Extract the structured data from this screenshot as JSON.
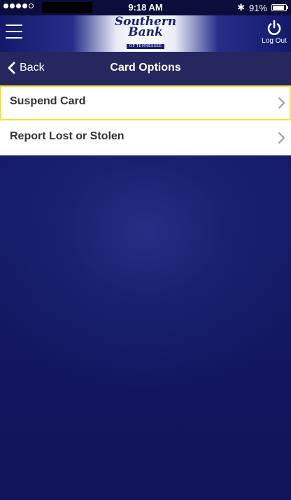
{
  "status_bar": {
    "time": "9:18 AM",
    "battery_percent": "91%",
    "battery_level": 0.91,
    "signal_bars": 4
  },
  "header": {
    "logo": {
      "line1": "Southern",
      "line2": "Bank",
      "line3": "OF TENNESSEE"
    },
    "logout_label": "Log Out",
    "menu_icon": "hamburger-menu-icon",
    "logout_icon": "power-icon"
  },
  "nav": {
    "back_label": "Back",
    "title": "Card Options"
  },
  "options": [
    {
      "label": "Suspend Card",
      "highlighted": true
    },
    {
      "label": "Report Lost or Stolen",
      "highlighted": false
    }
  ],
  "colors": {
    "background": "#141a66",
    "nav_bar": "#25275e",
    "highlight_border": "#f2e33b"
  }
}
